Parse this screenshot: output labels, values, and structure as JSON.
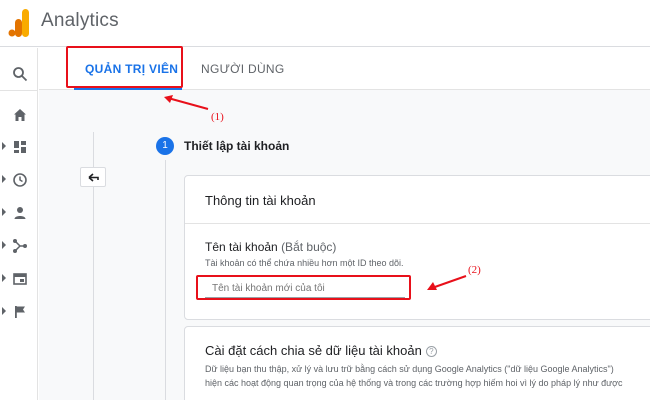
{
  "app": {
    "title": "Analytics"
  },
  "tabs": [
    {
      "label": "QUẢN TRỊ VIÊN"
    },
    {
      "label": "NGƯỜI DÙNG"
    }
  ],
  "annotations": {
    "tab": "(1)",
    "input": "(2)"
  },
  "step": {
    "number": "1",
    "title": "Thiết lập tài khoản"
  },
  "account_card": {
    "title": "Thông tin tài khoản",
    "field_label": "Tên tài khoản",
    "field_required": "(Bắt buộc)",
    "field_hint": "Tài khoản có thể chứa nhiều hơn một ID theo dõi.",
    "field_placeholder": "Tên tài khoản mới của tôi"
  },
  "sharing_card": {
    "title": "Cài đặt cách chia sẻ dữ liệu tài khoản",
    "help": "?",
    "desc_line1": "Dữ liệu bạn thu thập, xử lý và lưu trữ bằng cách sử dụng Google Analytics (\"dữ liệu Google Analytics\")",
    "desc_line2": "hiện các hoạt động quan trọng của hệ thống và trong các trường hợp hiếm hoi vì lý do pháp lý như được"
  },
  "colors": {
    "accent": "#1a73e8",
    "annotation": "#e8101a"
  }
}
